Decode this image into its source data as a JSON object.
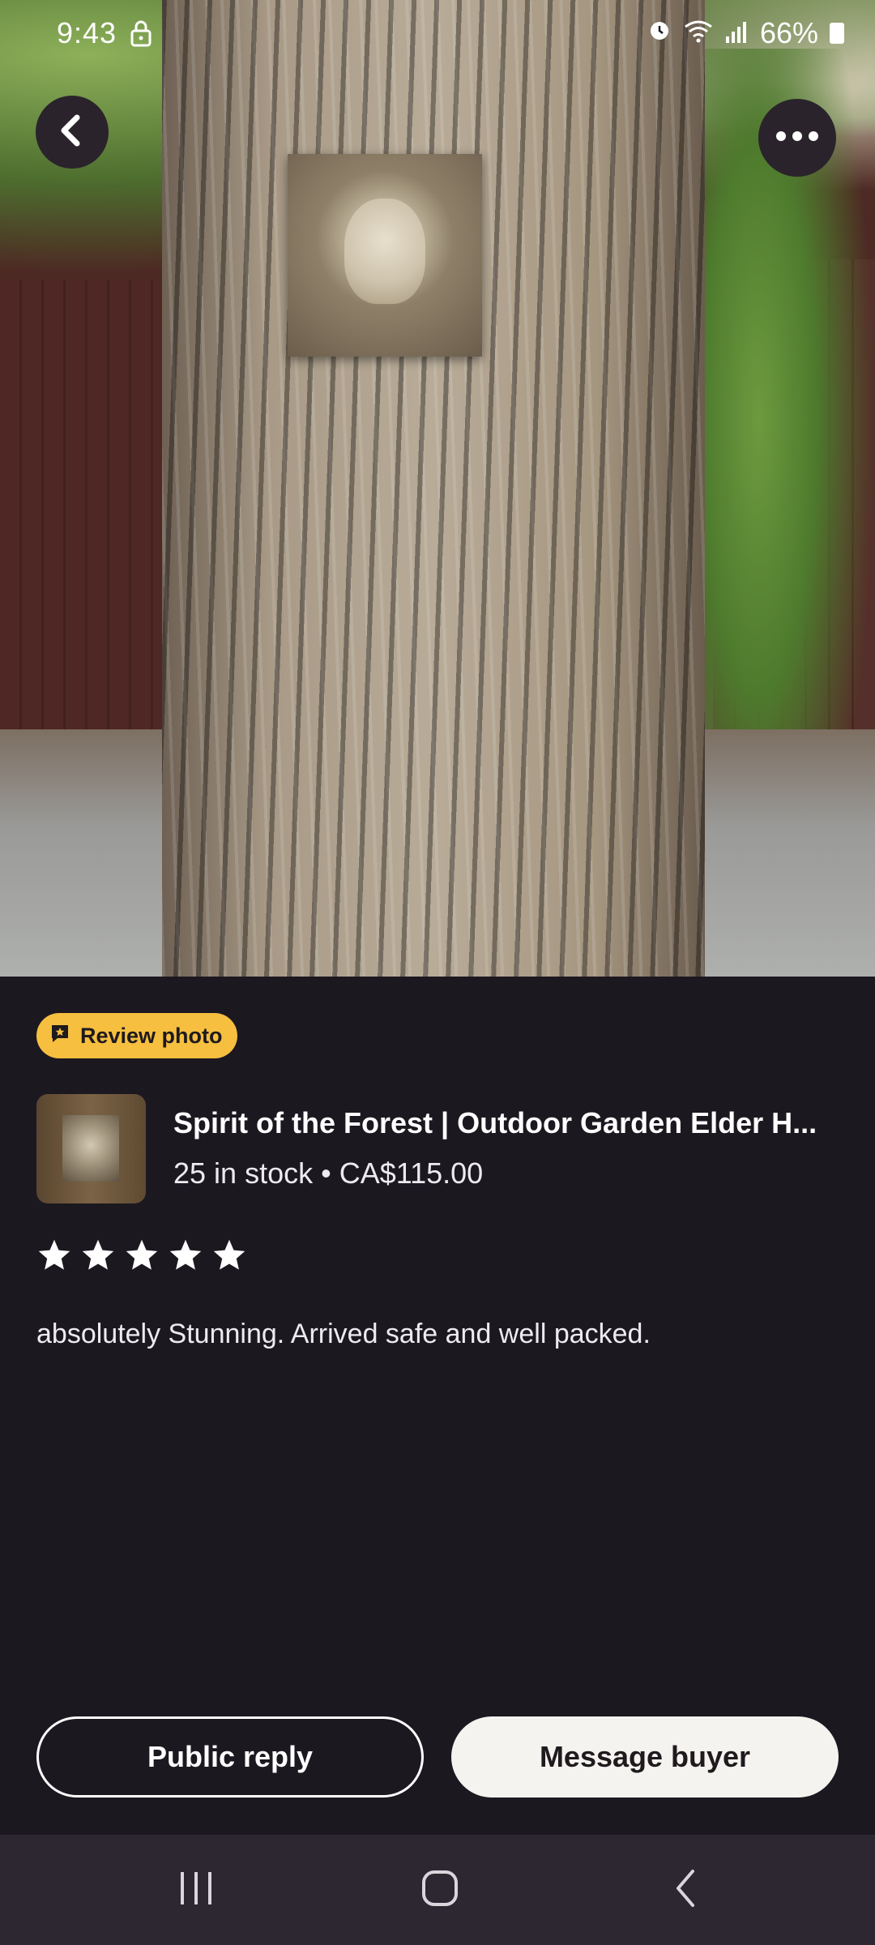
{
  "status_bar": {
    "time": "9:43",
    "battery": "66%"
  },
  "photo": {
    "icons": [
      "back-arrow-icon",
      "more-dots-icon"
    ]
  },
  "review": {
    "badge_label": "Review photo",
    "product_title": "Spirit of the Forest | Outdoor Garden Elder H...",
    "stock_price": "25 in stock • CA$115.00",
    "rating": 5,
    "rating_max": 5,
    "text": "absolutely Stunning.  Arrived safe and well packed."
  },
  "actions": {
    "public_reply": "Public reply",
    "message_buyer": "Message buyer"
  },
  "colors": {
    "background": "#1c1820",
    "badge": "#f6bf3f",
    "primary_button": "#f5f3ef",
    "navbar": "#2c2731"
  },
  "nav_bar": {
    "icons": [
      "recents-icon",
      "home-icon",
      "back-icon"
    ]
  }
}
